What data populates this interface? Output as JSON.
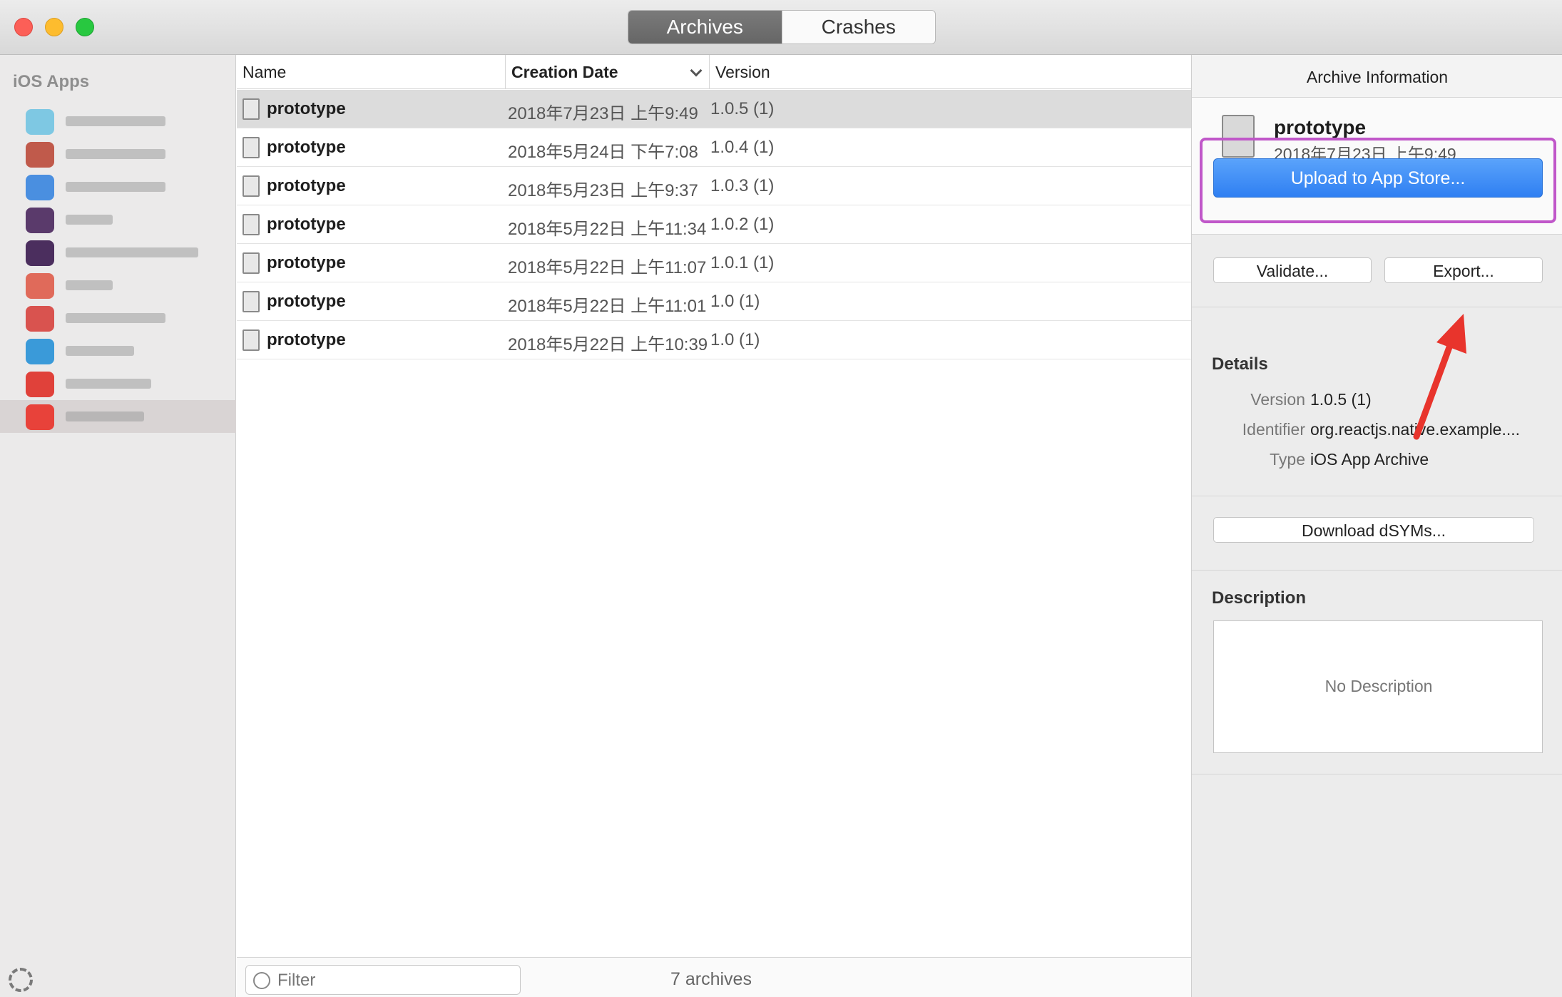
{
  "window": {
    "tabs": [
      {
        "label": "Archives",
        "active": true
      },
      {
        "label": "Crashes",
        "active": false
      }
    ]
  },
  "sidebar": {
    "heading": "iOS Apps",
    "apps": [
      {
        "icon_color": "#7ec8e3",
        "selected": false
      },
      {
        "icon_color": "#c05a4b",
        "selected": false
      },
      {
        "icon_color": "#4a8fe0",
        "selected": false
      },
      {
        "icon_color": "#5a3a6b",
        "selected": false
      },
      {
        "icon_color": "#4b2e5e",
        "selected": false
      },
      {
        "icon_color": "#e06a5a",
        "selected": false
      },
      {
        "icon_color": "#d9534f",
        "selected": false
      },
      {
        "icon_color": "#3a9ad9",
        "selected": false
      },
      {
        "icon_color": "#e0413a",
        "selected": false
      },
      {
        "icon_color": "#e8423a",
        "selected": true
      }
    ]
  },
  "list": {
    "columns": {
      "name": "Name",
      "date": "Creation Date",
      "version": "Version"
    },
    "rows": [
      {
        "name": "prototype",
        "date": "2018年7月23日 上午9:49",
        "version": "1.0.5 (1)",
        "selected": true
      },
      {
        "name": "prototype",
        "date": "2018年5月24日 下午7:08",
        "version": "1.0.4 (1)",
        "selected": false
      },
      {
        "name": "prototype",
        "date": "2018年5月23日 上午9:37",
        "version": "1.0.3 (1)",
        "selected": false
      },
      {
        "name": "prototype",
        "date": "2018年5月22日 上午11:34",
        "version": "1.0.2 (1)",
        "selected": false
      },
      {
        "name": "prototype",
        "date": "2018年5月22日 上午11:07",
        "version": "1.0.1 (1)",
        "selected": false
      },
      {
        "name": "prototype",
        "date": "2018年5月22日 上午11:01",
        "version": "1.0 (1)",
        "selected": false
      },
      {
        "name": "prototype",
        "date": "2018年5月22日 上午10:39",
        "version": "1.0 (1)",
        "selected": false
      }
    ],
    "filter_placeholder": "Filter",
    "count_label": "7 archives"
  },
  "inspector": {
    "title": "Archive Information",
    "archive_name": "prototype",
    "archive_date": "2018年7月23日 上午9:49",
    "upload_label": "Upload to App Store...",
    "validate_label": "Validate...",
    "export_label": "Export...",
    "details_title": "Details",
    "details": [
      {
        "label": "Version",
        "value": "1.0.5 (1)"
      },
      {
        "label": "Identifier",
        "value": "org.reactjs.native.example...."
      },
      {
        "label": "Type",
        "value": "iOS App Archive"
      }
    ],
    "dsym_label": "Download dSYMs...",
    "description_title": "Description",
    "description_placeholder": "No Description"
  },
  "colors": {
    "accent_blue": "#2f7ff2",
    "highlight_purple": "#c057c9",
    "annotation_red": "#e8342c"
  }
}
